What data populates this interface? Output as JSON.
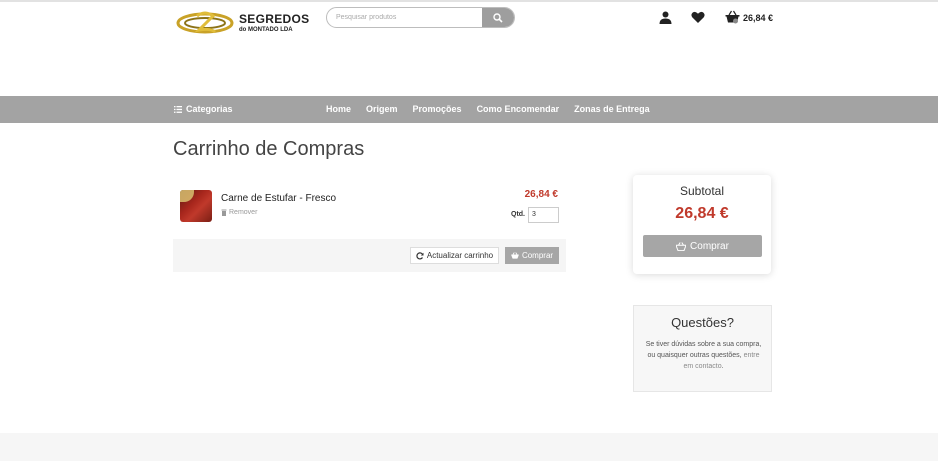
{
  "header": {
    "logo_title": "SEGREDOS",
    "logo_sub": "do MONTADO LDA",
    "search_placeholder": "Pesquisar produtos",
    "cart_total": "26,84 €"
  },
  "nav": {
    "categories_label": "Categorias",
    "links": [
      "Home",
      "Origem",
      "Promoções",
      "Como Encomendar",
      "Zonas de Entrega"
    ]
  },
  "page": {
    "title": "Carrinho de Compras"
  },
  "cart": {
    "items": [
      {
        "name": "Carne de Estufar - Fresco",
        "remove_label": "Remover",
        "price": "26,84 €",
        "qty_label": "Qtd.",
        "qty": "3"
      }
    ],
    "update_label": "Actualizar carrinho",
    "buy_label": "Comprar"
  },
  "summary": {
    "subtotal_label": "Subtotal",
    "subtotal_value": "26,84 €",
    "buy_label": "Comprar"
  },
  "questions": {
    "title": "Questões?",
    "text": "Se tiver dúvidas sobre a sua compra, ou quaisquer outras questões,",
    "link": "entre em contacto",
    "end": "."
  },
  "colors": {
    "nav_bg": "#a3a3a3",
    "price": "#c0392b",
    "button_bg": "#a6a6a6"
  },
  "icons": {
    "search": "search-icon",
    "user": "user-icon",
    "wishlist": "heart-icon",
    "cart": "basket-icon",
    "menu": "menu-icon",
    "trash": "trash-icon",
    "refresh": "refresh-icon"
  }
}
